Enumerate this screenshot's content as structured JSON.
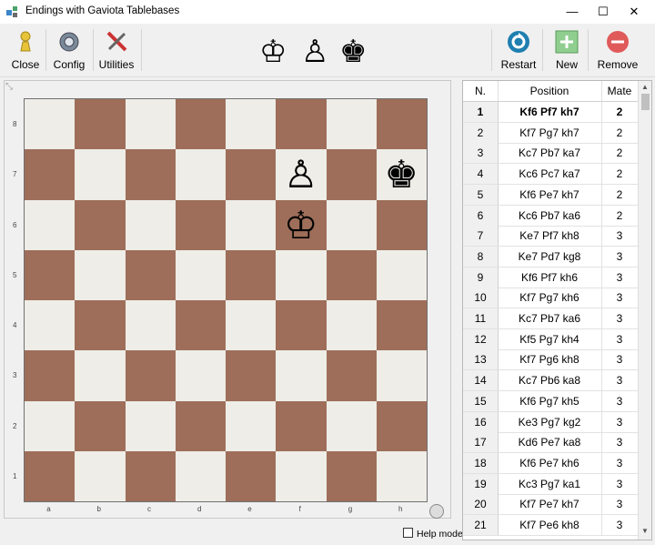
{
  "window": {
    "title": "Endings with Gaviota Tablebases",
    "minimize": "—",
    "maximize": "☐",
    "close": "✕"
  },
  "toolbar": {
    "close_label": "Close",
    "config_label": "Config",
    "utilities_label": "Utilities",
    "restart_label": "Restart",
    "new_label": "New",
    "remove_label": "Remove",
    "pieces": [
      "♔",
      "♙",
      "♚"
    ]
  },
  "board": {
    "pieces": [
      {
        "glyph": "♙",
        "square": "f7"
      },
      {
        "glyph": "♚",
        "square": "h7"
      },
      {
        "glyph": "♔",
        "square": "f6"
      }
    ],
    "ranks": [
      "8",
      "7",
      "6",
      "5",
      "4",
      "3",
      "2",
      "1"
    ],
    "files": [
      "a",
      "b",
      "c",
      "d",
      "e",
      "f",
      "g",
      "h"
    ]
  },
  "help_mode_label": "Help mode",
  "table": {
    "headers": [
      "N.",
      "Position",
      "Mate"
    ],
    "rows": [
      [
        "1",
        "Kf6 Pf7 kh7",
        "2"
      ],
      [
        "2",
        "Kf7 Pg7 kh7",
        "2"
      ],
      [
        "3",
        "Kc7 Pb7 ka7",
        "2"
      ],
      [
        "4",
        "Kc6 Pc7 ka7",
        "2"
      ],
      [
        "5",
        "Kf6 Pe7 kh7",
        "2"
      ],
      [
        "6",
        "Kc6 Pb7 ka6",
        "2"
      ],
      [
        "7",
        "Ke7 Pf7 kh8",
        "3"
      ],
      [
        "8",
        "Ke7 Pd7 kg8",
        "3"
      ],
      [
        "9",
        "Kf6 Pf7 kh6",
        "3"
      ],
      [
        "10",
        "Kf7 Pg7 kh6",
        "3"
      ],
      [
        "11",
        "Kc7 Pb7 ka6",
        "3"
      ],
      [
        "12",
        "Kf5 Pg7 kh4",
        "3"
      ],
      [
        "13",
        "Kf7 Pg6 kh8",
        "3"
      ],
      [
        "14",
        "Kc7 Pb6 ka8",
        "3"
      ],
      [
        "15",
        "Kf6 Pg7 kh5",
        "3"
      ],
      [
        "16",
        "Ke3 Pg7 kg2",
        "3"
      ],
      [
        "17",
        "Kd6 Pe7 ka8",
        "3"
      ],
      [
        "18",
        "Kf6 Pe7 kh6",
        "3"
      ],
      [
        "19",
        "Kc3 Pg7 ka1",
        "3"
      ],
      [
        "20",
        "Kf7 Pe7 kh7",
        "3"
      ],
      [
        "21",
        "Kf7 Pe6 kh8",
        "3"
      ]
    ]
  },
  "colors": {
    "light_square": "#eeede7",
    "dark_square": "#9e6e5a",
    "restart": "#1f7fb0",
    "new": "#7bc47f",
    "remove": "#e05a5a"
  }
}
